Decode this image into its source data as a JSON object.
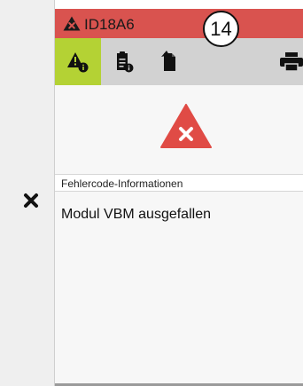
{
  "header": {
    "code": "ID18A6",
    "badge_number": "14",
    "background_color": "#d9534f"
  },
  "toolbar": {
    "items": [
      {
        "icon": "warning-info-icon",
        "active": true
      },
      {
        "icon": "clipboard-info-icon",
        "active": false
      },
      {
        "icon": "document-stack-icon",
        "active": false
      },
      {
        "icon": "printer-icon",
        "active": false
      }
    ],
    "active_color": "#b4d234"
  },
  "content": {
    "status_icon": "error-warning-icon",
    "status_color": "#e04b45",
    "section_title": "Fehlercode-Informationen",
    "message": "Modul VBM ausgefallen"
  },
  "sidebar": {
    "close_icon": "close-icon"
  }
}
